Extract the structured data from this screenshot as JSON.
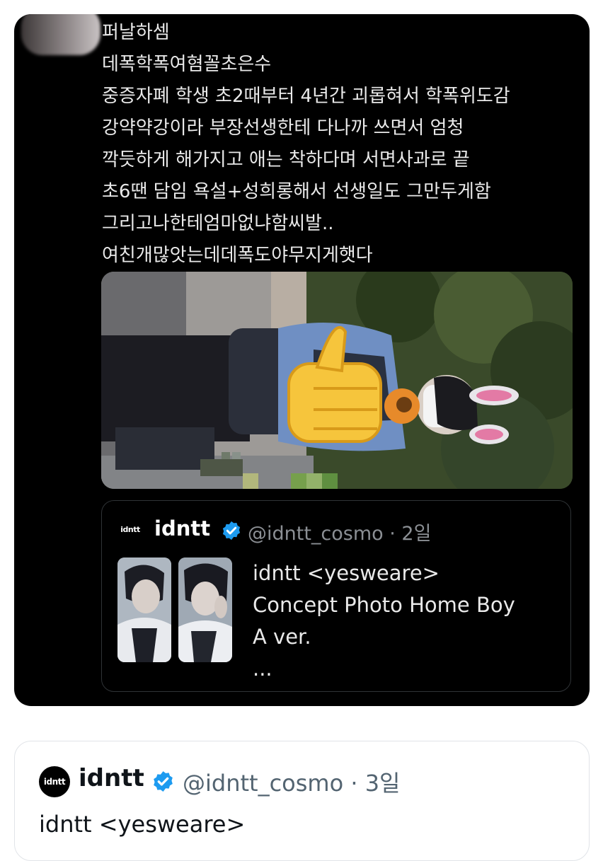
{
  "tweet": {
    "lines": [
      "퍼날하셈",
      "데폭학폭여혐꼴초은수",
      "중증자폐 학생 초2때부터 4년간 괴롭혀서 학폭위도감",
      "강약약강이라 부장선생한테 다나까 쓰면서 엄청",
      "깍듯하게 해가지고 애는 착하다며 서면사과로 끝",
      "초6땐 담임 욕설+성희롱해서 선생일도 그만두게함",
      "그리고나한테엄마없냐함씨발..",
      "여친개많앗는데데폭도야무지게햇다"
    ]
  },
  "quote_card": {
    "logo_text": "idntt",
    "name": "idntt",
    "handle": "@idntt_cosmo · 2일",
    "text_lines": [
      "idntt <yesweare>",
      "Concept Photo Home Boy",
      "A ver.",
      "..."
    ]
  },
  "below_card": {
    "logo_text": "idntt",
    "name": "idntt",
    "handle": "@idntt_cosmo · 3일",
    "text": "idntt <yesweare>"
  },
  "icons": {
    "verified": "verified-badge-icon",
    "thumbs_up": "thumbs-up-sticker-icon"
  },
  "colors": {
    "verified_blue": "#1d9bf0",
    "dark_bg": "#000000",
    "muted_text": "#8b8f94"
  }
}
